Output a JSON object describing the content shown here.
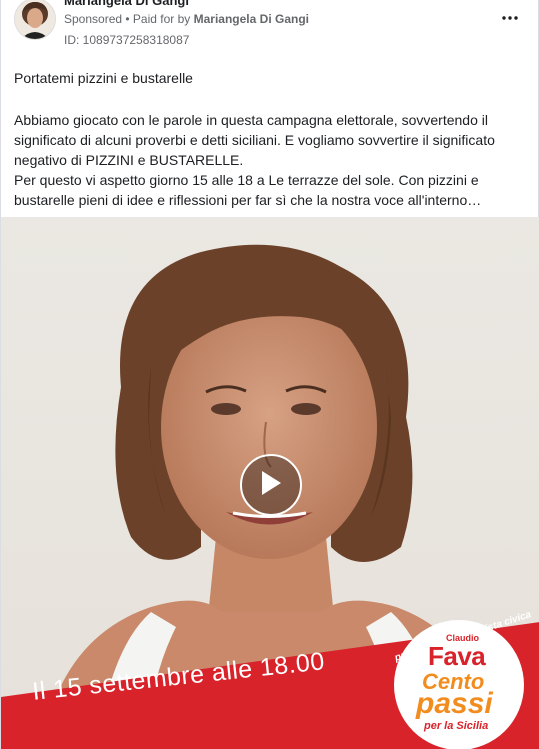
{
  "header": {
    "page_name": "Mariangela Di Gangi",
    "sponsored_label": "Sponsored",
    "paid_prefix": " • Paid for by ",
    "paid_by": "Mariangela Di Gangi",
    "ad_id": "ID: 1089737258318087",
    "more_icon": "more-horizontal-icon"
  },
  "post": {
    "headline": "Portatemi pizzini e bustarelle",
    "paragraph1": "Abbiamo giocato con le parole in questa campagna elettorale, sovvertendo il significato di alcuni proverbi e detti siciliani. E vogliamo sovvertire il significato negativo di PIZZINI e BUSTARELLE.",
    "paragraph2": "Per questo vi aspetto giorno 15 alle 18 a Le terrazze del sole. Con pizzini e bustarelle pieni di idee e riflessioni per far sì che la nostra voce all'interno…"
  },
  "video": {
    "play_icon": "play-icon",
    "banner_text": "Il 15 settembre alle 18.00",
    "logo": {
      "arc_text": "progressista ecologista civica",
      "name_small": "Claudio",
      "name_big": "Fava",
      "line1": "Cento",
      "line2": "passi",
      "line3": "per la Sicilia"
    }
  },
  "colors": {
    "banner_red": "#d8232a",
    "logo_orange": "#f28c1e",
    "meta_gray": "#65676b"
  }
}
